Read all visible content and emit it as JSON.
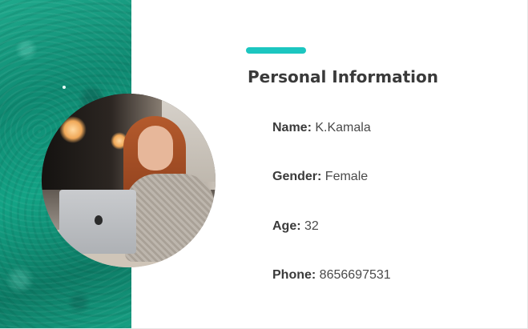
{
  "section": {
    "title": "Personal Information",
    "accent_color": "#1cc6c0"
  },
  "profile": {
    "photo_icon": "profile-photo",
    "fields": [
      {
        "label": "Name:",
        "value": "K.Kamala"
      },
      {
        "label": "Gender:",
        "value": "Female"
      },
      {
        "label": "Age:",
        "value": "32"
      },
      {
        "label": "Phone:",
        "value": "8656697531"
      }
    ]
  },
  "background": {
    "panel_color": "#139a80"
  }
}
